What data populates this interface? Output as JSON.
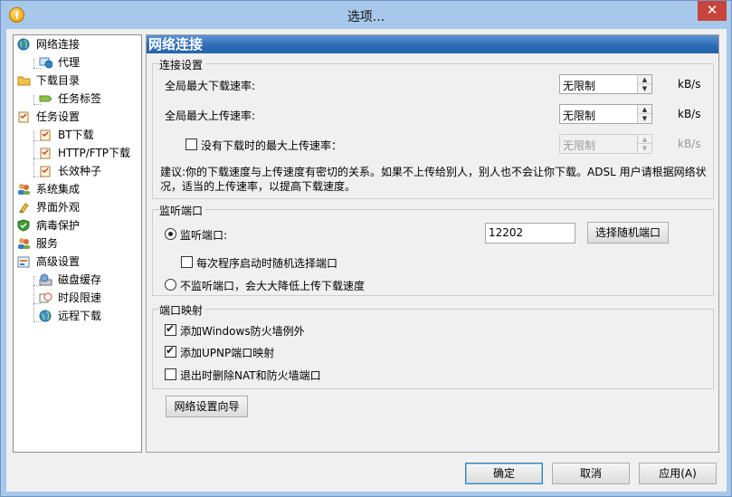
{
  "window": {
    "title": "选项..."
  },
  "tree": {
    "items": [
      {
        "label": "网络连接",
        "icon": "globe-network-icon"
      },
      {
        "label": "代理",
        "icon": "proxy-computer-icon"
      },
      {
        "label": "下载目录",
        "icon": "folder-icon"
      },
      {
        "label": "任务标签",
        "icon": "tag-icon"
      },
      {
        "label": "任务设置",
        "icon": "clipboard-icon"
      },
      {
        "label": "BT下载",
        "icon": "clipboard-icon"
      },
      {
        "label": "HTTP/FTP下载",
        "icon": "clipboard-icon"
      },
      {
        "label": "长效种子",
        "icon": "clipboard-icon"
      },
      {
        "label": "系统集成",
        "icon": "users-icon"
      },
      {
        "label": "界面外观",
        "icon": "paint-brush-icon"
      },
      {
        "label": "病毒保护",
        "icon": "shield-icon"
      },
      {
        "label": "服务",
        "icon": "users-icon"
      },
      {
        "label": "高级设置",
        "icon": "settings-panel-icon"
      },
      {
        "label": "磁盘缓存",
        "icon": "disk-cache-icon"
      },
      {
        "label": "时段限速",
        "icon": "schedule-icon"
      },
      {
        "label": "远程下载",
        "icon": "remote-globe-icon"
      }
    ]
  },
  "panel": {
    "header": "网络连接",
    "connection": {
      "group_title": "连接设置",
      "download_label": "全局最大下载速率:",
      "download_value": "无限制",
      "upload_label": "全局最大上传速率:",
      "upload_value": "无限制",
      "no_download_label": "没有下载时的最大上传速率：",
      "no_download_value": "无限制",
      "no_download_checked": false,
      "unit": "kB/s",
      "advice": "建议:你的下载速度与上传速度有密切的关系。如果不上传给别人，别人也不会让你下载。ADSL 用户请根据网络状况，适当的上传速率，以提高下载速度。"
    },
    "listen": {
      "group_title": "监听端口",
      "listen_label": "监听端口:",
      "listen_selected": true,
      "port_value": "12202",
      "random_button": "选择随机端口",
      "random_on_start_label": "每次程序启动时随机选择端口",
      "random_on_start_checked": false,
      "no_listen_label": "不监听端口，会大大降低上传下载速度",
      "no_listen_selected": false
    },
    "mapping": {
      "group_title": "端口映射",
      "items": [
        {
          "label": "添加Windows防火墙例外",
          "checked": true
        },
        {
          "label": "添加UPNP端口映射",
          "checked": true
        },
        {
          "label": "退出时删除NAT和防火墙端口",
          "checked": false
        }
      ]
    },
    "wizard_button": "网络设置向导"
  },
  "footer": {
    "ok": "确定",
    "cancel": "取消",
    "apply": "应用(A)"
  },
  "colors": {
    "frame": "#a7c8ea",
    "header_gradient_top": "#5b93d4",
    "header_gradient_bottom": "#2664ad",
    "close_button": "#c7443a"
  }
}
